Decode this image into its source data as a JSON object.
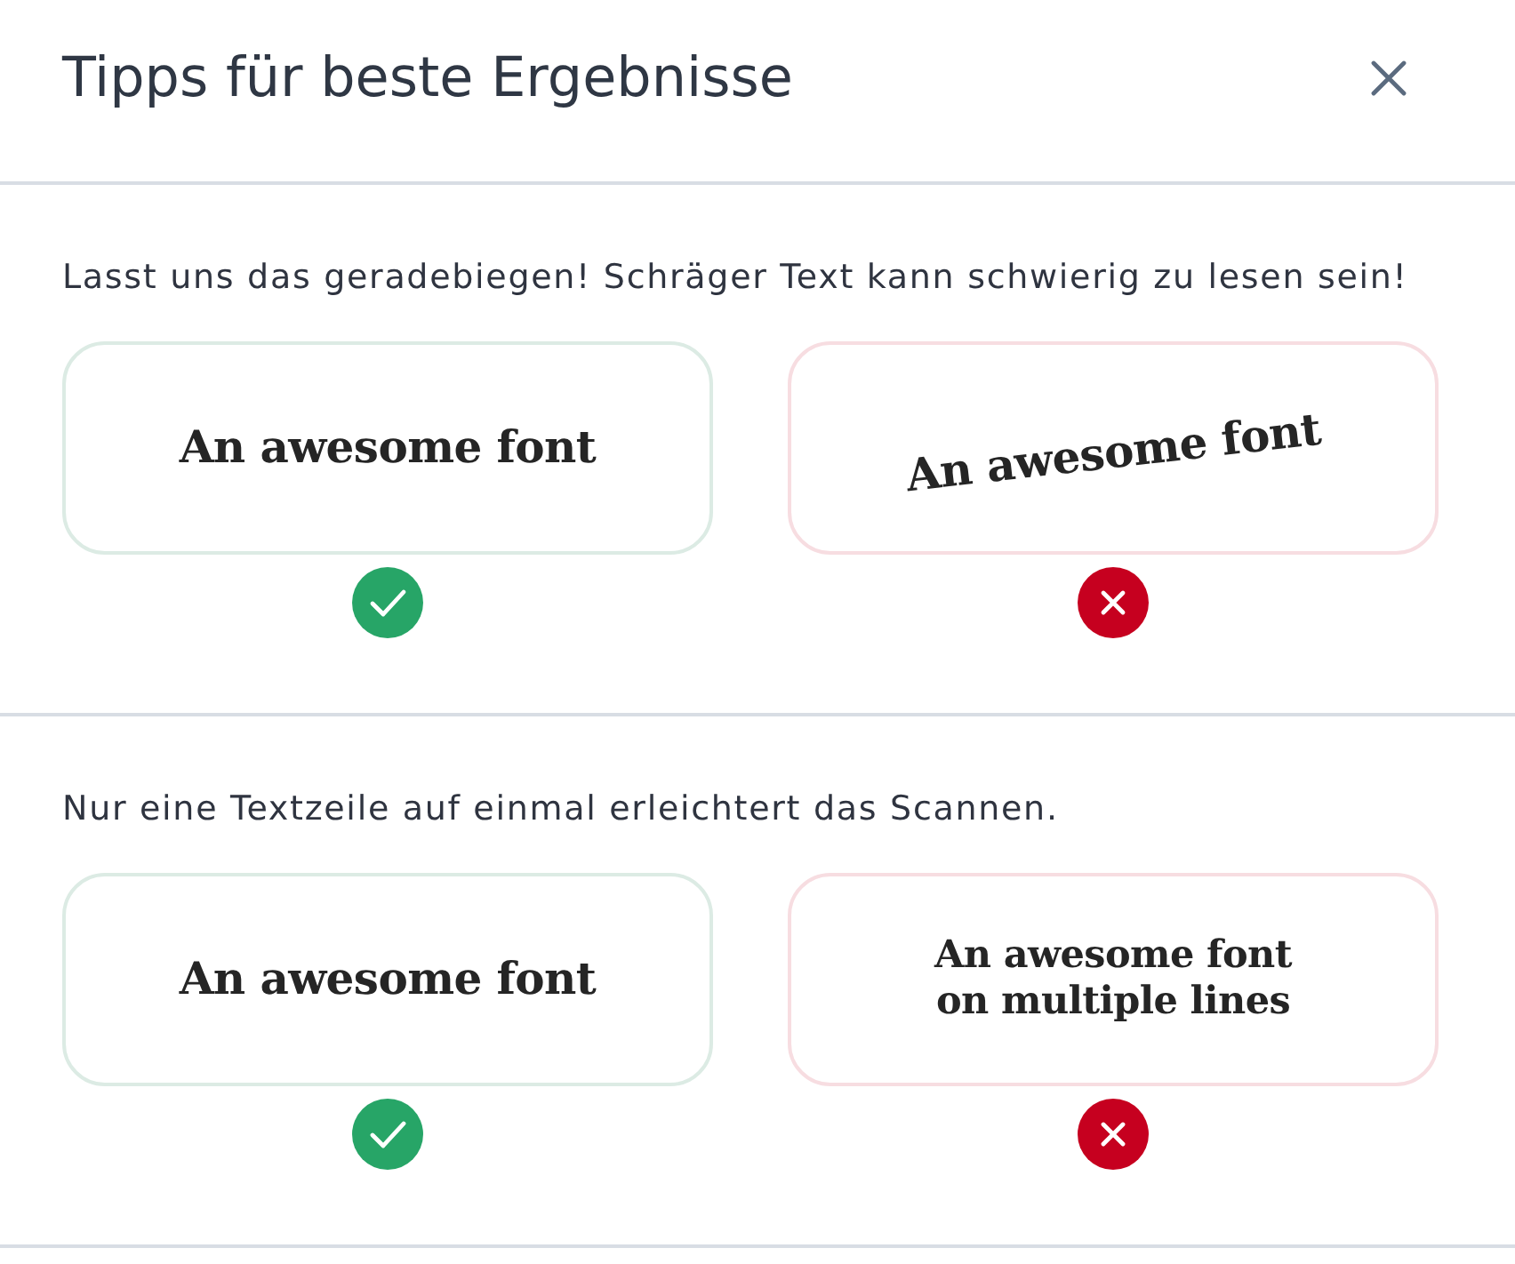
{
  "dialog": {
    "title": "Tipps für beste Ergebnisse"
  },
  "tips": [
    {
      "text": "Lasst uns das geradebiegen! Schräger Text kann schwierig zu lesen sein!",
      "examples": [
        {
          "kind": "correct",
          "tilted": false,
          "lines": [
            "An awesome font"
          ]
        },
        {
          "kind": "incorrect",
          "tilted": true,
          "lines": [
            "An awesome font"
          ]
        }
      ]
    },
    {
      "text": "Nur eine Textzeile auf einmal erleichtert das Scannen.",
      "examples": [
        {
          "kind": "correct",
          "tilted": false,
          "lines": [
            "An awesome font"
          ]
        },
        {
          "kind": "incorrect",
          "tilted": false,
          "lines": [
            "An awesome font",
            "on multiple lines"
          ]
        }
      ]
    }
  ]
}
